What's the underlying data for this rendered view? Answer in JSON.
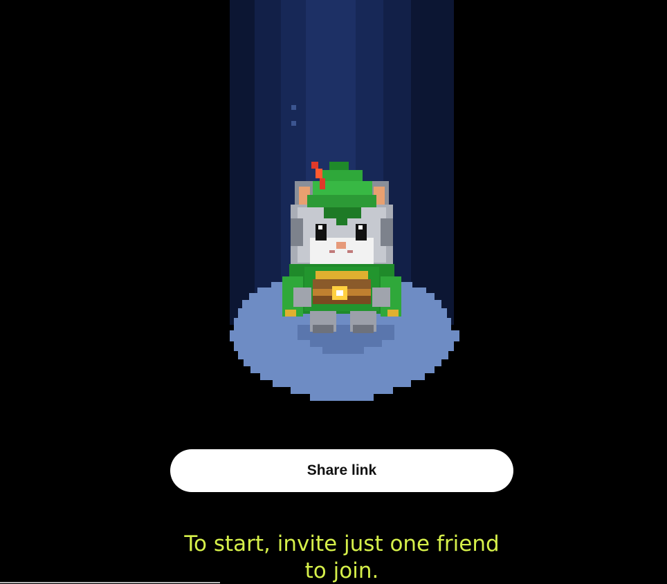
{
  "screen": {
    "background_color": "#000000"
  },
  "scene": {
    "character": "cat-in-green-archer-hat",
    "beam_colors": [
      "#0f1a3a",
      "#142450",
      "#1b2e60",
      "#22386e",
      "#1b2e60",
      "#142450",
      "#0f1a3a"
    ],
    "spotlight_color": "#6f8fc6"
  },
  "share_button": {
    "label": "Share link",
    "background_color": "#ffffff"
  },
  "invite_message": {
    "line1": "To start, invite just one friend",
    "line2": "to join.",
    "color": "#d6f04a"
  }
}
